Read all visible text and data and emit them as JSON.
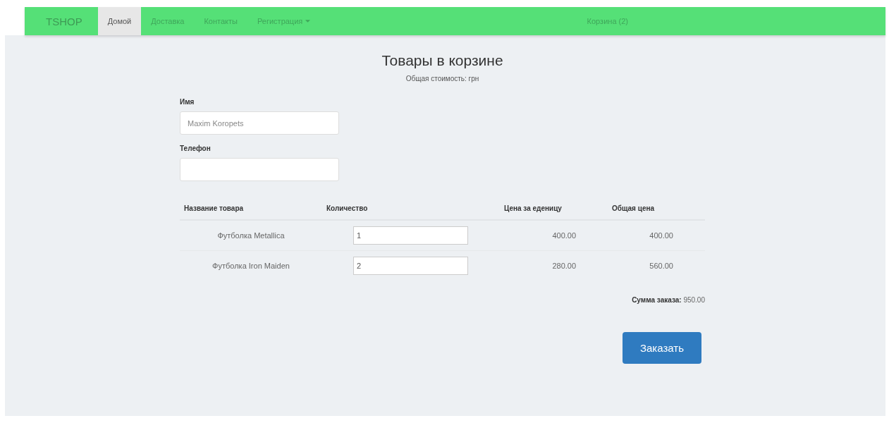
{
  "navbar": {
    "brand": "TSHOP",
    "items": [
      {
        "label": "Домой",
        "selected": true,
        "dropdown": false
      },
      {
        "label": "Доставка",
        "selected": false,
        "dropdown": false
      },
      {
        "label": "Контакты",
        "selected": false,
        "dropdown": false
      },
      {
        "label": "Регистрация",
        "selected": false,
        "dropdown": true
      }
    ],
    "cart": "Корзина (2)"
  },
  "title": "Товары в корзине",
  "subtitle": "Общая стоимость: грн",
  "form": {
    "fields": [
      {
        "label": "Имя",
        "placeholder": "Maxim Koropets"
      },
      {
        "label": "Телефон"
      }
    ]
  },
  "table": {
    "columns": [
      "Название товара",
      "Количество",
      "Цена за еденицу",
      "Общая цена"
    ],
    "rows": [
      {
        "name": "Футболка Metallica",
        "quantity": "1",
        "price": "400.00",
        "total": "400.00"
      },
      {
        "name": "Футболка Iron Maiden",
        "quantity": "2",
        "price": "280.00",
        "total": "560.00"
      }
    ]
  },
  "order_sum": "**Сумма заказа:** 950.00",
  "submit": "Заказать"
}
